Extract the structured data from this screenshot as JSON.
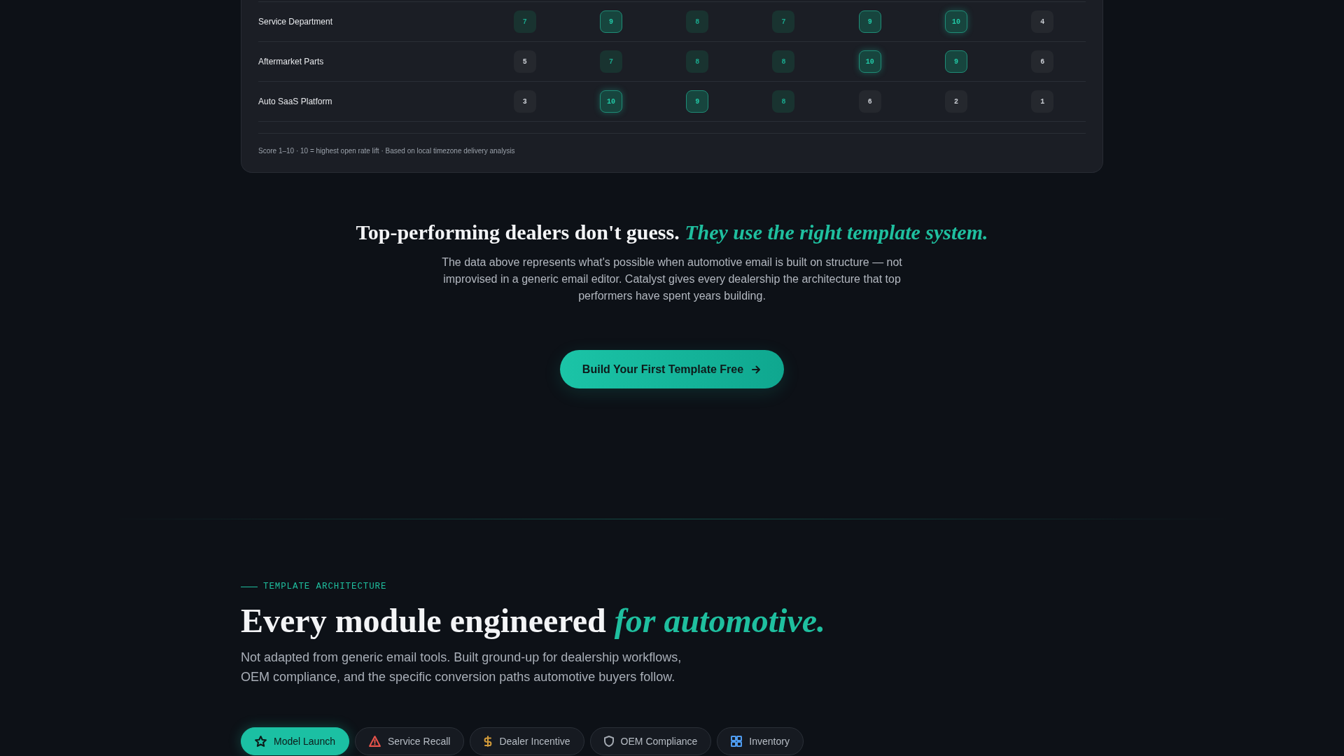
{
  "table": {
    "rows": [
      {
        "label": "Service Department",
        "cells": [
          {
            "score": "7",
            "kind": "mid"
          },
          {
            "score": "9",
            "kind": "high"
          },
          {
            "score": "8",
            "kind": "mid"
          },
          {
            "score": "7",
            "kind": "mid"
          },
          {
            "score": "9",
            "kind": "high"
          },
          {
            "score": "10",
            "kind": "top"
          },
          {
            "score": "4",
            "kind": "low"
          }
        ]
      },
      {
        "label": "Aftermarket Parts",
        "cells": [
          {
            "score": "5",
            "kind": "low"
          },
          {
            "score": "7",
            "kind": "mid"
          },
          {
            "score": "8",
            "kind": "mid"
          },
          {
            "score": "8",
            "kind": "mid"
          },
          {
            "score": "10",
            "kind": "top"
          },
          {
            "score": "9",
            "kind": "high"
          },
          {
            "score": "6",
            "kind": "low"
          }
        ]
      },
      {
        "label": "Auto SaaS Platform",
        "cells": [
          {
            "score": "3",
            "kind": "low"
          },
          {
            "score": "10",
            "kind": "top"
          },
          {
            "score": "9",
            "kind": "high"
          },
          {
            "score": "8",
            "kind": "mid"
          },
          {
            "score": "6",
            "kind": "low"
          },
          {
            "score": "2",
            "kind": "low"
          },
          {
            "score": "1",
            "kind": "low"
          }
        ]
      }
    ],
    "footnote": "Score 1–10 · 10 = highest open rate lift · Based on local timezone delivery analysis"
  },
  "closing": {
    "heading": "Top-performing dealers don't guess. *They use the right template system.*",
    "body": "The data above represents what's possible when automotive email is built on structure — not improvised in a generic email editor. Catalyst gives every dealership the architecture that top performers have spent years building.",
    "button": "Build Your First Template Free"
  },
  "section": {
    "eyebrow": "TEMPLATE ARCHITECTURE",
    "heading": "Every module engineered *for automotive.*",
    "body": "Not adapted from generic email tools. Built ground-up for dealership workflows, OEM compliance, and the specific conversion paths automotive buyers follow.",
    "tabs": [
      {
        "label": "Model Launch",
        "selected": true
      },
      {
        "label": "Service Recall",
        "selected": false,
        "color": "#e5534b"
      },
      {
        "label": "Dealer Incentive",
        "selected": false,
        "color": "#d29b3a"
      },
      {
        "label": "OEM Compliance",
        "selected": false,
        "color": "#a3a9b1"
      },
      {
        "label": "Inventory",
        "selected": false,
        "color": "#4f9cf0"
      }
    ]
  }
}
